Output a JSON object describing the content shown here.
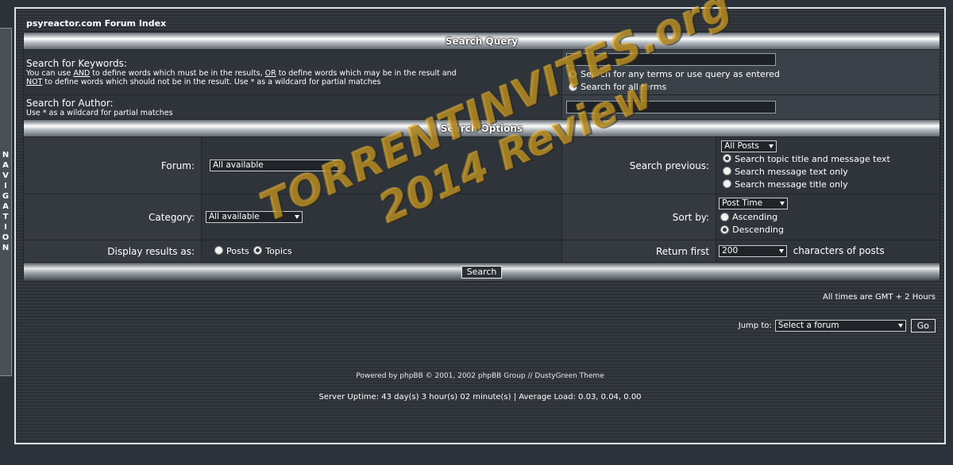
{
  "nav_tab": {
    "label": "NAVIGATION"
  },
  "header": {
    "forum_index_link": "psyreactor.com Forum Index"
  },
  "search_query": {
    "heading": "Search Query",
    "keywords_label": "Search for Keywords:",
    "keywords_help_1": "You can use ",
    "keywords_help_and": "AND",
    "keywords_help_2": " to define words which must be in the results, ",
    "keywords_help_or": "OR",
    "keywords_help_3": " to define words which may be in the result and",
    "keywords_help_not": "NOT",
    "keywords_help_4": " to define words which should not be in the result. Use * as a wildcard for partial matches",
    "keywords_value": "",
    "terms_any": "Search for any terms or use query as entered",
    "terms_all": "Search for all terms",
    "author_label": "Search for Author:",
    "author_help": "Use * as a wildcard for partial matches",
    "author_value": ""
  },
  "search_options": {
    "heading": "Search Options",
    "forum_label": "Forum:",
    "forum_value": "All available",
    "previous_label": "Search previous:",
    "previous_value": "All Posts",
    "scope_title_msg": "Search topic title and message text",
    "scope_msg": "Search message text only",
    "scope_title": "Search message title only",
    "category_label": "Category:",
    "category_value": "All available",
    "sort_label": "Sort by:",
    "sort_value": "Post Time",
    "ascending": "Ascending",
    "descending": "Descending",
    "display_label": "Display results as:",
    "display_posts": "Posts",
    "display_topics": "Topics",
    "return_first_label": "Return first",
    "return_first_value": "200",
    "characters_label": "characters of posts",
    "search_button": "Search"
  },
  "timezone": "All times are GMT + 2 Hours",
  "jump": {
    "label": "Jump to:",
    "value": "Select a forum",
    "go": "Go"
  },
  "footer": {
    "powered": "Powered by phpBB © 2001, 2002 phpBB Group // DustyGreen Theme",
    "uptime": "Server Uptime: 43 day(s) 3 hour(s) 02 minute(s) | Average Load: 0.03, 0.04, 0.00"
  },
  "watermark": {
    "line1": "TORRENTINVITES.org",
    "line2": "2014 Review"
  }
}
